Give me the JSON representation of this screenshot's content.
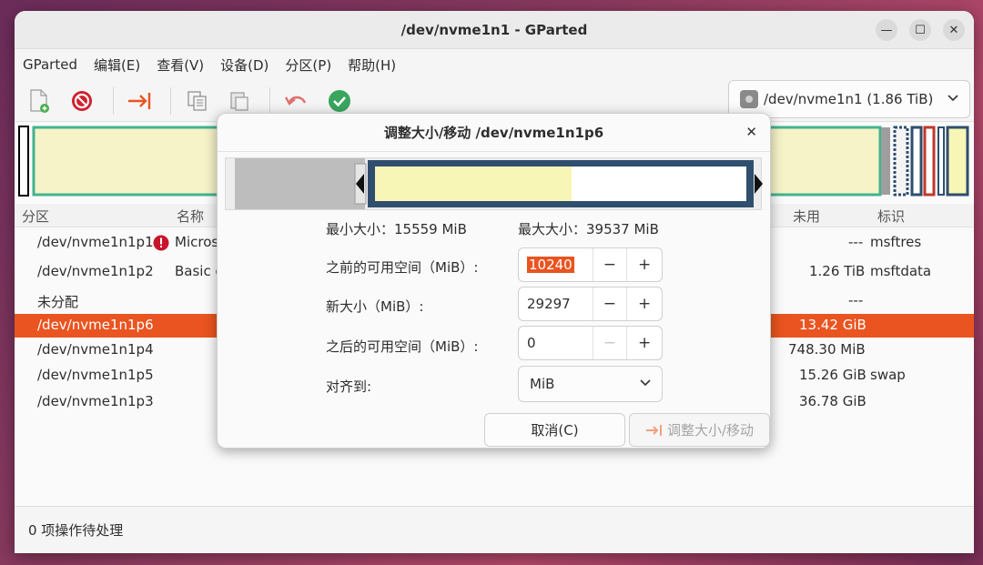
{
  "window": {
    "title": "/dev/nvme1n1 - GParted",
    "minimize_glyph": "—",
    "maximize_glyph": "☐",
    "close_glyph": "✕"
  },
  "menu": [
    "GParted",
    "编辑(E)",
    "查看(V)",
    "设备(D)",
    "分区(P)",
    "帮助(H)"
  ],
  "toolbar": {
    "icons": [
      "new-partition-icon",
      "delete-icon",
      "resize-move-icon",
      "copy-icon",
      "paste-icon",
      "undo-icon",
      "apply-icon"
    ]
  },
  "device_selector": {
    "value": "/dev/nvme1n1 (1.86 TiB)"
  },
  "colors": {
    "accent": "#e95420",
    "unallocated": "#c0c0c0",
    "partition_fill": "#f8f6b6",
    "ntfs_border": "#42b38f",
    "resize_border": "#304e6e"
  },
  "table": {
    "columns": {
      "partition": "分区",
      "name": "名称",
      "used": "未用",
      "flags": "标识"
    },
    "rows": [
      {
        "partition": "/dev/nvme1n1p1",
        "name": "Micros",
        "used": "---",
        "flags": "msftres",
        "warn": true
      },
      {
        "partition": "/dev/nvme1n1p2",
        "name": "Basic d",
        "used": "1.26 TiB",
        "flags": "msftdata"
      },
      {
        "partition": "未分配",
        "name": "",
        "used": "---",
        "flags": ""
      },
      {
        "partition": "/dev/nvme1n1p6",
        "name": "",
        "used": "13.42 GiB",
        "flags": "",
        "selected": true
      },
      {
        "partition": "/dev/nvme1n1p4",
        "name": "",
        "used": "748.30 MiB",
        "flags": ""
      },
      {
        "partition": "/dev/nvme1n1p5",
        "name": "",
        "used": "15.26 GiB",
        "flags": "swap"
      },
      {
        "partition": "/dev/nvme1n1p3",
        "name": "",
        "used": "36.78 GiB",
        "flags": ""
      }
    ]
  },
  "status": "0 项操作待处理",
  "dialog": {
    "title": "调整大小/移动 /dev/nvme1n1p6",
    "close_glyph": "✕",
    "min_size": "最小大小：15559 MiB",
    "max_size": "最大大小：39537 MiB",
    "before_label": "之前的可用空间（MiB）:",
    "before_value": "10240",
    "size_label": "新大小（MiB）:",
    "size_value": "29297",
    "after_label": "之后的可用空间（MiB）:",
    "after_value": "0",
    "align_label": "对齐到:",
    "align_value": "MiB",
    "minus": "−",
    "plus": "+",
    "cancel": "取消(C)",
    "apply": "调整大小/移动"
  }
}
